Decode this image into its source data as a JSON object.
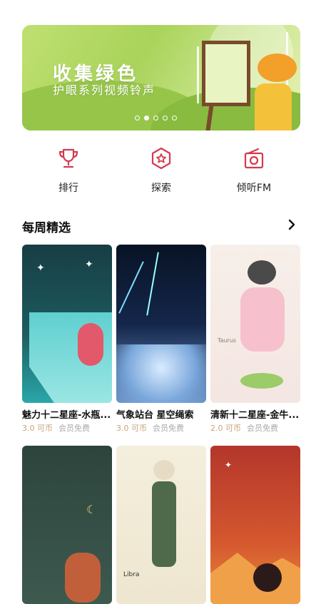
{
  "banner": {
    "title": "收集绿色",
    "subtitle": "护眼系列视频铃声",
    "dots_total": 5,
    "dots_active": 1
  },
  "nav": {
    "items": [
      {
        "label": "排行",
        "icon": "trophy-icon"
      },
      {
        "label": "探索",
        "icon": "explore-icon"
      },
      {
        "label": "倾听FM",
        "icon": "radio-icon"
      }
    ]
  },
  "section": {
    "title": "每周精选",
    "more_icon": "chevron-right-icon"
  },
  "cards": [
    {
      "title": "魅力十二星座-水瓶...",
      "price": "3.0 可币",
      "member": "会员免费"
    },
    {
      "title": "气象站台 星空绳索",
      "price": "3.0 可币",
      "member": "会员免费"
    },
    {
      "title": "清新十二星座-金牛...",
      "price": "2.0 可币",
      "member": "会员免费",
      "thumb_text": "Taurus"
    },
    {
      "title": "",
      "price": "",
      "member": ""
    },
    {
      "title": "",
      "price": "",
      "member": "",
      "thumb_text": "Libra"
    },
    {
      "title": "",
      "price": "",
      "member": ""
    }
  ],
  "colors": {
    "accent": "#d23b4f",
    "price": "#c9a47b"
  }
}
